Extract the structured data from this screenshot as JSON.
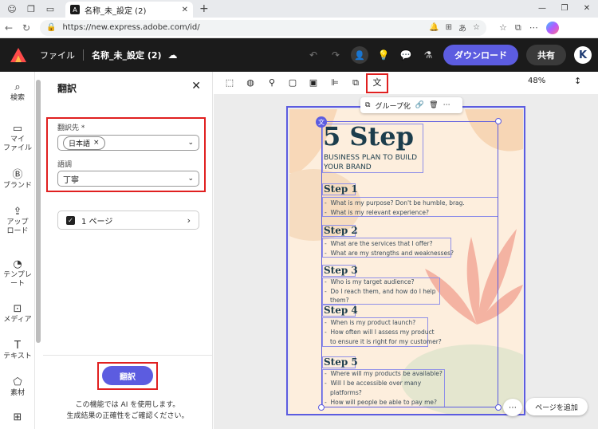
{
  "browser": {
    "tab_title": "名称_未_設定 (2)",
    "url": "https://new.express.adobe.com/id/",
    "tab_close": "✕",
    "new_tab": "+"
  },
  "header": {
    "file_menu": "ファイル",
    "doc_name": "名称_未_設定 (2)",
    "download_label": "ダウンロード",
    "share_label": "共有",
    "avatar_letter": "K"
  },
  "rail": {
    "items": [
      {
        "label": "検索",
        "icon": "search-icon"
      },
      {
        "label": "マイ\nファイル",
        "icon": "folder-icon"
      },
      {
        "label": "ブランド",
        "icon": "brand-icon"
      },
      {
        "label": "アップ\nロード",
        "icon": "upload-icon"
      },
      {
        "label": "テンプレ\nート",
        "icon": "template-icon"
      },
      {
        "label": "メディア",
        "icon": "media-icon"
      },
      {
        "label": "テキスト",
        "icon": "text-icon"
      },
      {
        "label": "素材",
        "icon": "elements-icon"
      }
    ]
  },
  "panel": {
    "title": "翻訳",
    "target_label": "翻訳先 *",
    "target_value": "日本語",
    "tone_label": "語調",
    "tone_value": "丁寧",
    "pages_label": "1 ページ",
    "translate_button": "翻訳",
    "note_line1": "この機能では AI を使用します。",
    "note_line2": "生成結果の正確性をご確認ください。"
  },
  "canvas": {
    "zoom": "48%",
    "context_label": "グループ化",
    "add_page": "ページを追加"
  },
  "document": {
    "heading": "5 Step",
    "subheading": "BUSINESS PLAN TO BUILD YOUR BRAND",
    "steps": [
      {
        "title": "Step 1",
        "bullets": [
          "What is my purpose? Don't be humble, brag.",
          "What is my relevant experience?"
        ]
      },
      {
        "title": "Step 2",
        "bullets": [
          "What are the services that I offer?",
          "What are my strengths and weaknesses?"
        ]
      },
      {
        "title": "Step 3",
        "bullets": [
          "Who is my target audience?",
          "Do I reach them, and how do I help",
          "them?"
        ]
      },
      {
        "title": "Step 4",
        "bullets": [
          "When is my product launch?",
          "How often will I assess my product",
          "to ensure it is right for my customer?"
        ]
      },
      {
        "title": "Step 5",
        "bullets": [
          "Where will my products be available?",
          "Will I be accessible over many",
          "platforms?",
          "How will people be able to pay me?"
        ]
      }
    ]
  },
  "colors": {
    "accent": "#5c5ce0",
    "highlight": "#e02020",
    "header_bg": "#1b1b1b",
    "page_bg": "#fdeedd",
    "heading_text": "#1c3d4c"
  }
}
